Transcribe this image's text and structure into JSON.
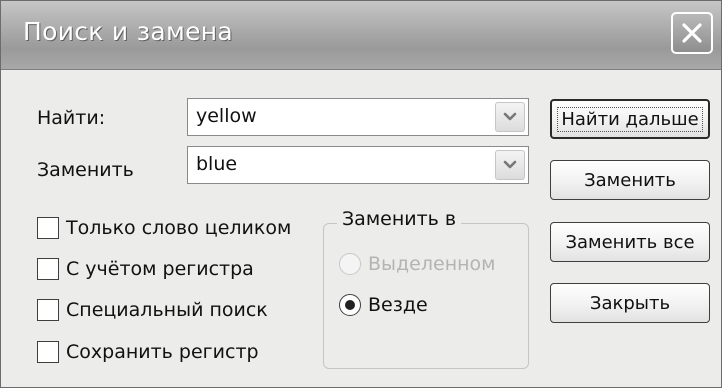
{
  "window": {
    "title": "Поиск и замена"
  },
  "find": {
    "label": "Найти:",
    "value": "yellow"
  },
  "replace": {
    "label": "Заменить",
    "value": "blue"
  },
  "buttons": {
    "find_next": "Найти дальше",
    "replace": "Заменить",
    "replace_all": "Заменить все",
    "close": "Закрыть"
  },
  "options": [
    {
      "label": "Только слово целиком",
      "checked": false
    },
    {
      "label": "С учётом регистра",
      "checked": false
    },
    {
      "label": "Специальный поиск",
      "checked": false
    },
    {
      "label": "Сохранить регистр",
      "checked": false
    }
  ],
  "replace_in": {
    "legend": "Заменить в",
    "choices": [
      {
        "label": "Выделенном",
        "selected": false,
        "enabled": false
      },
      {
        "label": "Везде",
        "selected": true,
        "enabled": true
      }
    ]
  },
  "icons": {
    "close": "close-icon",
    "dropdown": "chevron-down-icon"
  }
}
